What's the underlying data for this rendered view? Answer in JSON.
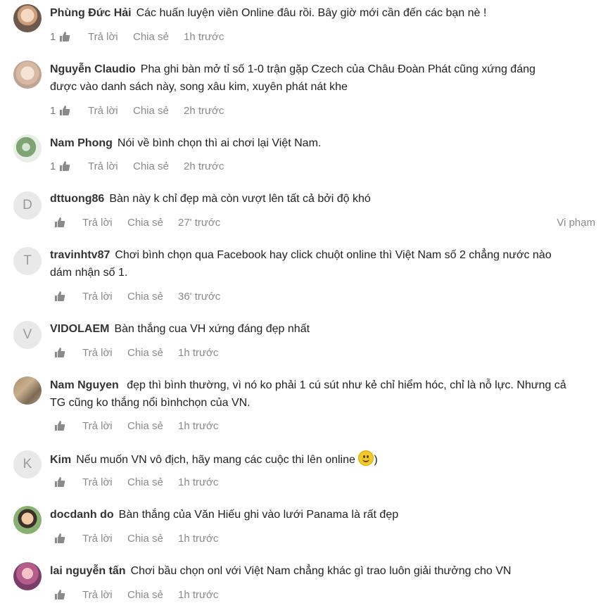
{
  "comments": [
    {
      "author": "Phùng Đức Hải",
      "avatar": "photo1",
      "line1": "Các huấn luyện viên Online đâu rồi. Bây giờ mới cần đến các bạn nè !",
      "likes": "1",
      "reply": "Trả lời",
      "share": "Chia sẻ",
      "time": "1h trước"
    },
    {
      "author": "Nguyễn Claudio",
      "avatar": "photo2",
      "line1": "Pha ghi bàn mở tỉ số 1-0 trận gặp Czech của Châu Đoàn Phát cũng xứng đáng",
      "line2": "được vào danh sách này, song xâu kim, xuyên phát nát khe",
      "likes": "1",
      "reply": "Trả lời",
      "share": "Chia sẻ",
      "time": "2h trước"
    },
    {
      "author": "Nam Phong",
      "avatar": "photo3",
      "line1": "Nói về bình chọn thì ai chơi lại Việt Nam.",
      "likes": "1",
      "reply": "Trả lời",
      "share": "Chia sẻ",
      "time": "2h trước"
    },
    {
      "author": "dttuong86",
      "initial": "D",
      "line1": "Bàn này k chỉ đẹp mà còn vượt lên tất cả bởi độ khó",
      "reply": "Trả lời",
      "share": "Chia sẻ",
      "time": "27' trước",
      "report": "Vi phạm"
    },
    {
      "author": "travinhtv87",
      "initial": "T",
      "line1": "Chơi bình chọn qua Facebook hay click chuột online thì Việt Nam số 2 chẳng nước nào",
      "line2": "dám nhận số 1.",
      "reply": "Trả lời",
      "share": "Chia sẻ",
      "time": "36' trước"
    },
    {
      "author": "VIDOLAEM",
      "initial": "V",
      "line1": "Bàn thắng cua VH xứng đáng đẹp nhất",
      "reply": "Trả lời",
      "share": "Chia sẻ",
      "time": "1h trước"
    },
    {
      "author": "Nam Nguyen",
      "avatar": "photo4",
      "line1": " đẹp thì bình thường, vì nó ko phải 1 cú sút như kẻ chỉ hiểm hóc, chỉ là nỗ lực. Nhưng cả",
      "line2": "TG cũng ko thắng nổi bìnhchọn của VN.",
      "reply": "Trả lời",
      "share": "Chia sẻ",
      "time": "1h trước"
    },
    {
      "author": "Kim",
      "initial": "K",
      "line1": "Nếu muốn VN vô địch, hãy mang các cuộc thi lên online ",
      "line1_suffix": ")",
      "emoji": "smile-emoji",
      "reply": "Trả lời",
      "share": "Chia sẻ",
      "time": "1h trước"
    },
    {
      "author": "docdanh do",
      "avatar": "photo5",
      "line1": "Bàn thắng của Văn Hiếu ghi vào lưới Panama là rất đẹp",
      "reply": "Trả lời",
      "share": "Chia sẻ",
      "time": "1h trước"
    },
    {
      "author": "lai nguyễn tấn",
      "avatar": "photo6",
      "line1": "Chơi bầu chọn onl với Việt Nam chẳng khác gì trao luôn giải thưởng cho VN",
      "reply": "Trả lời",
      "share": "Chia sẻ",
      "time": "1h trước"
    }
  ],
  "colors": {
    "text": "#222222",
    "muted": "#8a8a8a",
    "avatar_bg": "#e9e9e9"
  },
  "icons": {
    "like": "thumbs-up-icon",
    "emoji": "smile-emoji-icon"
  }
}
